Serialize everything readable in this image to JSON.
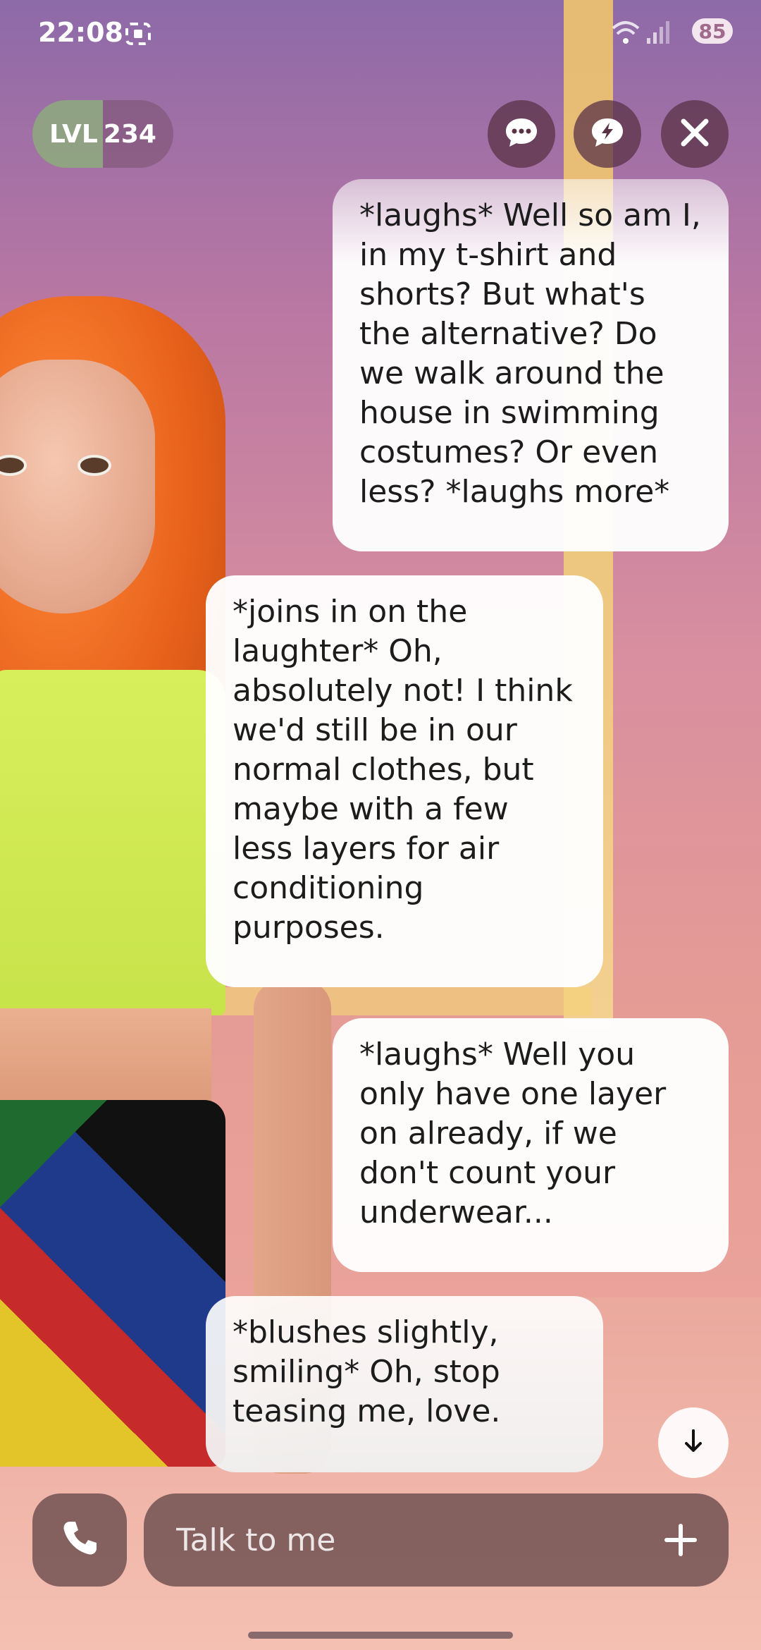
{
  "status_bar": {
    "time": "22:08",
    "battery": "85",
    "icons": [
      "screenshot-icon",
      "wifi-icon",
      "signal-icon",
      "battery-icon"
    ]
  },
  "header": {
    "level_prefix": "LVL",
    "level_value": "234",
    "level_progress": 0.5,
    "buttons": [
      "chat-icon",
      "quick-chat-icon",
      "close-icon"
    ]
  },
  "messages": [
    {
      "from": "user",
      "text": "*laughs* Well so am I, in my t-shirt and shorts? But what's the alternative? Do we walk around the house in swimming costumes? Or even less? *laughs more*"
    },
    {
      "from": "bot",
      "text": "*joins in on the laughter* Oh, absolutely not! I think we'd still be in our normal clothes, but maybe with a few less layers for air conditioning purposes."
    },
    {
      "from": "user",
      "text": "*laughs* Well you only have one layer on already, if we don't count your underwear..."
    },
    {
      "from": "bot",
      "text": "*blushes slightly, smiling* Oh, stop teasing me, love."
    }
  ],
  "input": {
    "placeholder": "Talk to me"
  },
  "colors": {
    "bubble": "#ffffff",
    "control_bg": "#5a3246",
    "input_bg": "#694b4b"
  }
}
